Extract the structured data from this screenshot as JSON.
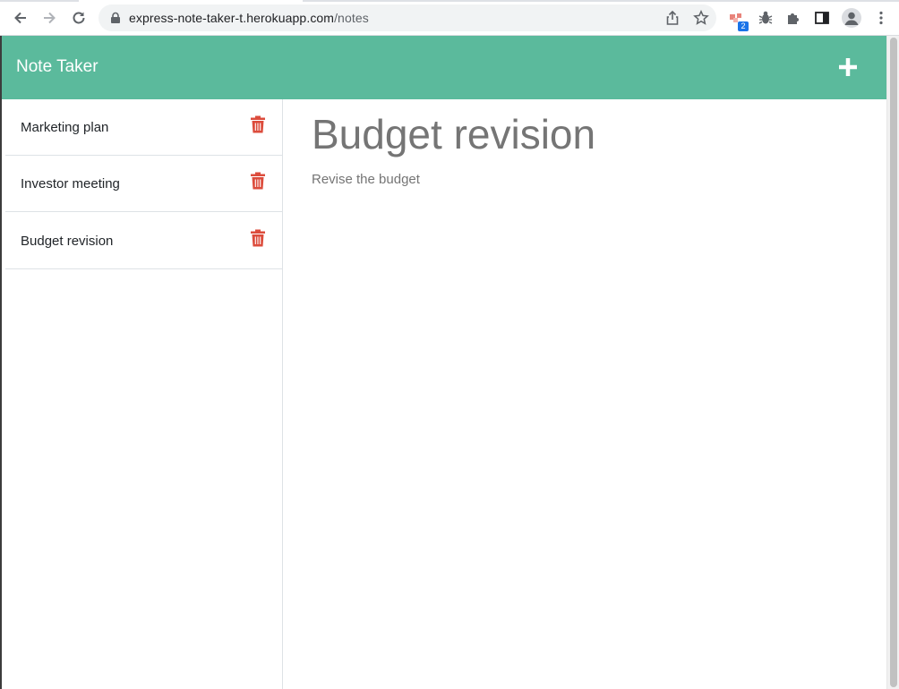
{
  "browser": {
    "url_host": "express-note-taker-t.herokuapp.com",
    "url_path": "/notes",
    "extension_badge": "2"
  },
  "app": {
    "brand": "Note Taker",
    "add_icon": "plus-icon"
  },
  "notes": [
    {
      "title": "Marketing plan"
    },
    {
      "title": "Investor meeting"
    },
    {
      "title": "Budget revision"
    }
  ],
  "active_note": {
    "title": "Budget revision",
    "text": "Revise the budget"
  },
  "colors": {
    "navbar": "#5bba9c",
    "delete_icon": "#dc4c3c",
    "note_text": "#757575"
  }
}
